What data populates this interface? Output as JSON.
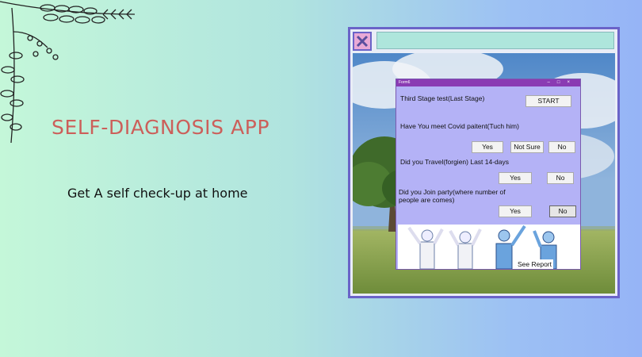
{
  "slide": {
    "title": "SELF-DIAGNOSIS APP",
    "subtitle": "Get A self check-up at home"
  },
  "app_window": {
    "title": "Form6",
    "controls": "–□×",
    "stage_label": "Third Stage test(Last Stage)",
    "start_label": "START",
    "questions": [
      {
        "text": "Have You meet Covid paitent(Tuch him)",
        "options": [
          "Yes",
          "Not Sure",
          "No"
        ]
      },
      {
        "text": "Did you Travel(forgien) Last 14-days",
        "options": [
          "Yes",
          "No"
        ]
      },
      {
        "text": "Did you Join party(where number of\npeople are comes)",
        "options": [
          "Yes",
          "No"
        ]
      }
    ],
    "see_report_label": "See Report"
  },
  "colors": {
    "title": "#cc5f5a",
    "frame_border": "#6a63c8",
    "window_bg": "#b4b2f6",
    "titlebar": "#8a3bb3"
  },
  "icons": [
    "close-x-icon",
    "botanical-branch-icon",
    "healthcare-workers-illustration"
  ]
}
